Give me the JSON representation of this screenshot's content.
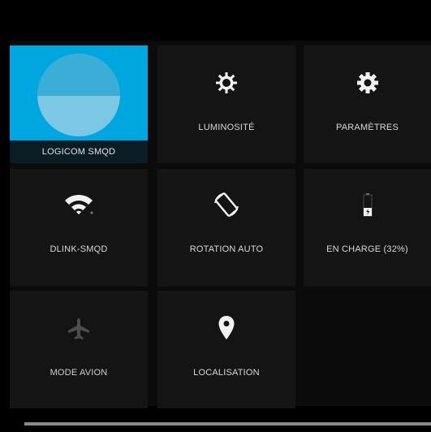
{
  "quick_settings": {
    "user_tile": {
      "label": "LOGICOM SMQD",
      "icon": "user-avatar-icon",
      "accent": "#00a6df"
    },
    "brightness": {
      "label": "LUMINOSITÉ",
      "icon": "brightness-icon"
    },
    "settings": {
      "label": "PARAMÈTRES",
      "icon": "gear-icon"
    },
    "wifi": {
      "label": "DLINK-SMQD",
      "icon": "wifi-icon"
    },
    "rotation": {
      "label": "ROTATION AUTO",
      "icon": "auto-rotate-icon"
    },
    "battery": {
      "label": "EN CHARGE (32%)",
      "icon": "battery-charging-icon",
      "level_fraction": 0.32
    },
    "airplane": {
      "label": "MODE AVION",
      "icon": "airplane-icon",
      "enabled": false
    },
    "location": {
      "label": "LOCALISATION",
      "icon": "location-pin-icon"
    }
  }
}
